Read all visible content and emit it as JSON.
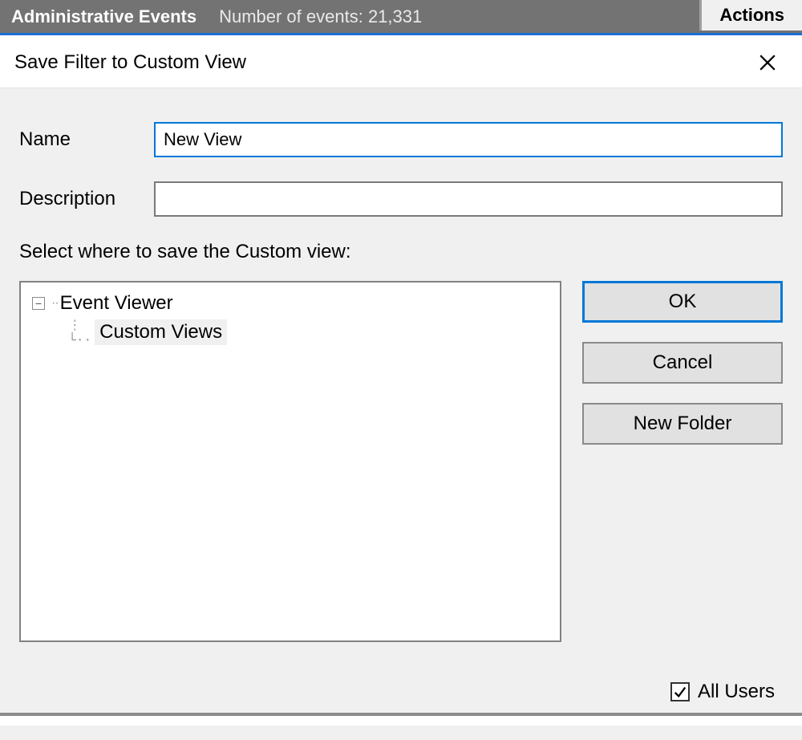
{
  "header": {
    "title": "Administrative Events",
    "count_label": "Number of events: 21,331",
    "actions_label": "Actions"
  },
  "dialog": {
    "title": "Save Filter to Custom View",
    "fields": {
      "name_label": "Name",
      "name_value": "New View",
      "description_label": "Description",
      "description_value": ""
    },
    "select_label": "Select where to save the Custom view:",
    "tree": {
      "root": "Event Viewer",
      "child": "Custom Views"
    },
    "buttons": {
      "ok": "OK",
      "cancel": "Cancel",
      "new_folder": "New Folder"
    },
    "all_users_label": "All Users",
    "all_users_checked": true
  }
}
